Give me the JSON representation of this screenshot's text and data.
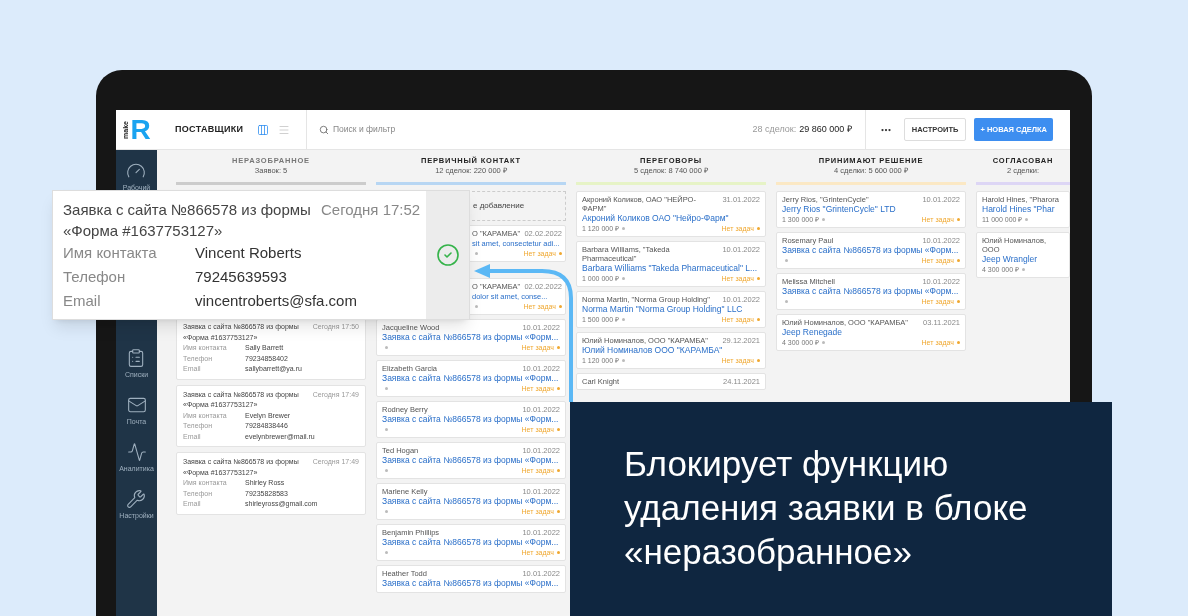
{
  "logo": {
    "small": "make",
    "big": "R"
  },
  "header": {
    "title": "ПОСТАВЩИКИ",
    "views": [
      {
        "kind": "kanban",
        "selected": true
      },
      {
        "kind": "list",
        "selected": false
      }
    ],
    "search": {
      "placeholder": "Поиск и фильтр"
    },
    "summary_label": "28 сделок:",
    "summary_total": "29 860 000 ₽",
    "buttons": [
      {
        "kind": "more"
      },
      {
        "kind": "secondary",
        "label": "НАСТРОИТЬ"
      },
      {
        "kind": "primary",
        "label": "+ НОВАЯ СДЕЛКА"
      }
    ]
  },
  "sidebar": {
    "items": [
      {
        "kind": "dashboard",
        "label": "Рабочий"
      },
      {
        "kind": "lists",
        "label": "Списки"
      },
      {
        "kind": "mail",
        "label": "Почта"
      },
      {
        "kind": "analytics",
        "label": "Аналитика"
      },
      {
        "kind": "settings",
        "label": "Настройки"
      }
    ]
  },
  "columns": [
    {
      "title": "НЕРАЗОБРАННОЕ",
      "subtitle": "Заявок: 5",
      "color": "#cccccc",
      "kind": "leads",
      "leads": [
        {
          "title": "Заявка с сайта №866578 из формы «Форма #1637753127»",
          "time": "Сегодня 17:50",
          "fields": [
            {
              "label": "Имя контакта",
              "value": "Sally Barrett"
            },
            {
              "label": "Телефон",
              "value": "79234858402"
            },
            {
              "label": "Email",
              "value": "sallybarrett@ya.ru"
            }
          ]
        },
        {
          "title": "Заявка с сайта №866578 из формы «Форма #1637753127»",
          "time": "Сегодня 17:49",
          "fields": [
            {
              "label": "Имя контакта",
              "value": "Evelyn Brewer"
            },
            {
              "label": "Телефон",
              "value": "79284838446"
            },
            {
              "label": "Email",
              "value": "evelynbrewer@mail.ru"
            }
          ]
        },
        {
          "title": "Заявка с сайта №866578 из формы «Форма #1637753127»",
          "time": "Сегодня 17:49",
          "fields": [
            {
              "label": "Имя контакта",
              "value": "Shirley Ross"
            },
            {
              "label": "Телефон",
              "value": "79235828583"
            },
            {
              "label": "Email",
              "value": "shirleyross@gmail.com"
            }
          ]
        }
      ]
    },
    {
      "title": "ПЕРВИЧНЫЙ КОНТАКТ",
      "subtitle": "12 сделок: 220 000 ₽",
      "color": "#b7d6f3",
      "kind": "deals",
      "quick_add": "е добавление",
      "deals": [
        {
          "kind": "partial",
          "client": "О \"КАРАМБА\"",
          "date": "02.02.2022",
          "title": "sit amet, consectetur adi...",
          "tasks": "Нет задач"
        },
        {
          "kind": "partial",
          "client": "О \"КАРАМБА\"",
          "date": "02.02.2022",
          "title": "dolor sit amet, conse...",
          "tasks": "Нет задач"
        },
        {
          "kind": "full",
          "client": "Jacqueline Wood",
          "date": "10.01.2022",
          "title": "Заявка с сайта №866578 из формы «Форм...",
          "tasks": "Нет задач"
        },
        {
          "kind": "full",
          "client": "Elizabeth Garcia",
          "date": "10.01.2022",
          "title": "Заявка с сайта №866578 из формы «Форм...",
          "tasks": "Нет задач"
        },
        {
          "kind": "full",
          "client": "Rodney Berry",
          "date": "10.01.2022",
          "title": "Заявка с сайта №866578 из формы «Форм...",
          "tasks": "Нет задач"
        },
        {
          "kind": "full",
          "client": "Ted Hogan",
          "date": "10.01.2022",
          "title": "Заявка с сайта №866578 из формы «Форм...",
          "tasks": "Нет задач"
        },
        {
          "kind": "full",
          "client": "Marlene Kelly",
          "date": "10.01.2022",
          "title": "Заявка с сайта №866578 из формы «Форм...",
          "tasks": "Нет задач"
        },
        {
          "kind": "full",
          "client": "Benjamin Phillips",
          "date": "10.01.2022",
          "title": "Заявка с сайта №866578 из формы «Форм...",
          "tasks": "Нет задач"
        },
        {
          "kind": "full",
          "client": "Heather Todd",
          "date": "10.01.2022",
          "title": "Заявка с сайта №866578 из формы «Форм..."
        }
      ]
    },
    {
      "title": "ПЕРЕГОВОРЫ",
      "subtitle": "5 сделок: 8 740 000 ₽",
      "color": "#e6f3c6",
      "kind": "deals",
      "deals": [
        {
          "kind": "full",
          "client": "Акроний Коликов, ОАО \"НЕЙРО-ФАРМ\"",
          "date": "31.01.2022",
          "title": "Акроний Коликов ОАО \"Нейро-Фарм\"",
          "amount": "1 120 000 ₽",
          "tasks": "Нет задач"
        },
        {
          "kind": "full",
          "client": "Barbara Williams, \"Takeda Pharmaceutical\"",
          "date": "10.01.2022",
          "title": "Barbara Williams \"Takeda Pharmaceutical\" L...",
          "amount": "1 000 000 ₽",
          "tasks": "Нет задач"
        },
        {
          "kind": "full",
          "client": "Norma Martin, \"Norma Group Holding\"",
          "date": "10.01.2022",
          "title": "Norma Martin \"Norma Group Holding\" LLC",
          "amount": "1 500 000 ₽",
          "tasks": "Нет задач"
        },
        {
          "kind": "full",
          "client": "Юлий Номиналов, ООО \"КАРАМБА\"",
          "date": "29.12.2021",
          "title": "Юлий Номиналов ООО \"КАРАМБА\"",
          "amount": "1 120 000 ₽",
          "tasks": "Нет задач"
        },
        {
          "kind": "full",
          "client": "Carl Knight",
          "date": "24.11.2021"
        }
      ]
    },
    {
      "title": "ПРИНИМАЮТ РЕШЕНИЕ",
      "subtitle": "4 сделки: 5 600 000 ₽",
      "color": "#fbe8c4",
      "kind": "deals",
      "deals": [
        {
          "kind": "full",
          "client": "Jerry Rios, \"GrintenCycle\"",
          "date": "10.01.2022",
          "title": "Jerry Rios \"GrintenCycle\" LTD",
          "amount": "1 300 000 ₽",
          "tasks": "Нет задач"
        },
        {
          "kind": "full",
          "client": "Rosemary Paul",
          "date": "10.01.2022",
          "title": "Заявка с сайта №866578 из формы «Форм...",
          "tasks": "Нет задач"
        },
        {
          "kind": "full",
          "client": "Melissa Mitchell",
          "date": "10.01.2022",
          "title": "Заявка с сайта №866578 из формы «Форм...",
          "tasks": "Нет задач"
        },
        {
          "kind": "full",
          "client": "Юлий Номиналов, ООО \"КАРАМБА\"",
          "date": "03.11.2021",
          "title": "Jeep Renegade",
          "amount": "4 300 000 ₽",
          "tasks": "Нет задач"
        }
      ]
    },
    {
      "title": "СОГЛАСОВАН",
      "subtitle": "2 сделки:",
      "color": "#ddd6f5",
      "kind": "deals",
      "deals": [
        {
          "kind": "full",
          "client": "Harold Hines, \"Pharora",
          "title": "Harold Hines \"Phar",
          "amount": "11 000 000 ₽"
        },
        {
          "kind": "full",
          "client": "Юлий Номиналов, ООО",
          "title": "Jeep Wrangler",
          "amount": "4 300 000 ₽"
        }
      ]
    }
  ],
  "popup": {
    "title": "Заявка с сайта №866578 из формы «Форма #1637753127»",
    "time": "Сегодня 17:52",
    "fields": [
      {
        "label": "Имя контакта",
        "value": "Vincent Roberts"
      },
      {
        "label": "Телефон",
        "value": "79245639593"
      },
      {
        "label": "Email",
        "value": "vincentroberts@sfa.com"
      }
    ],
    "approved": true
  },
  "banner": {
    "text": "Блокирует функцию удаления заявки в блоке «неразобранное»"
  }
}
